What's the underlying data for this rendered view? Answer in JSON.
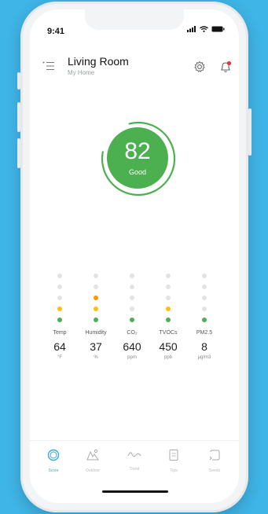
{
  "colors": {
    "background": "#3fb4e6",
    "good": "#4caf50",
    "yellow": "#ffc107",
    "orange": "#ff9800",
    "active_tab": "#36a9e1"
  },
  "status_bar": {
    "time": "9:41"
  },
  "header": {
    "title": "Living Room",
    "subtitle": "My Home"
  },
  "score": {
    "value": "82",
    "label": "Good"
  },
  "metrics": [
    {
      "label": "Temp",
      "value": "64",
      "unit": "°F",
      "dots": [
        "grey",
        "grey",
        "grey",
        "yellow",
        "green"
      ]
    },
    {
      "label": "Humidity",
      "value": "37",
      "unit": "%",
      "dots": [
        "grey",
        "grey",
        "orange",
        "yellow",
        "green"
      ]
    },
    {
      "label": "CO₂",
      "value": "640",
      "unit": "ppm",
      "dots": [
        "grey",
        "grey",
        "grey",
        "grey",
        "green"
      ]
    },
    {
      "label": "TVOCs",
      "value": "450",
      "unit": "ppb",
      "dots": [
        "grey",
        "grey",
        "grey",
        "yellow",
        "green"
      ]
    },
    {
      "label": "PM2.5",
      "value": "8",
      "unit": "µg/m3",
      "dots": [
        "grey",
        "grey",
        "grey",
        "grey",
        "green"
      ]
    }
  ],
  "tabs": [
    {
      "label": "Score",
      "icon": "score-ring-icon",
      "active": true
    },
    {
      "label": "Outdoor",
      "icon": "outdoor-icon",
      "active": false
    },
    {
      "label": "Trend",
      "icon": "trend-icon",
      "active": false
    },
    {
      "label": "Tips",
      "icon": "tips-icon",
      "active": false
    },
    {
      "label": "Seeds",
      "icon": "seeds-icon",
      "active": false
    }
  ]
}
